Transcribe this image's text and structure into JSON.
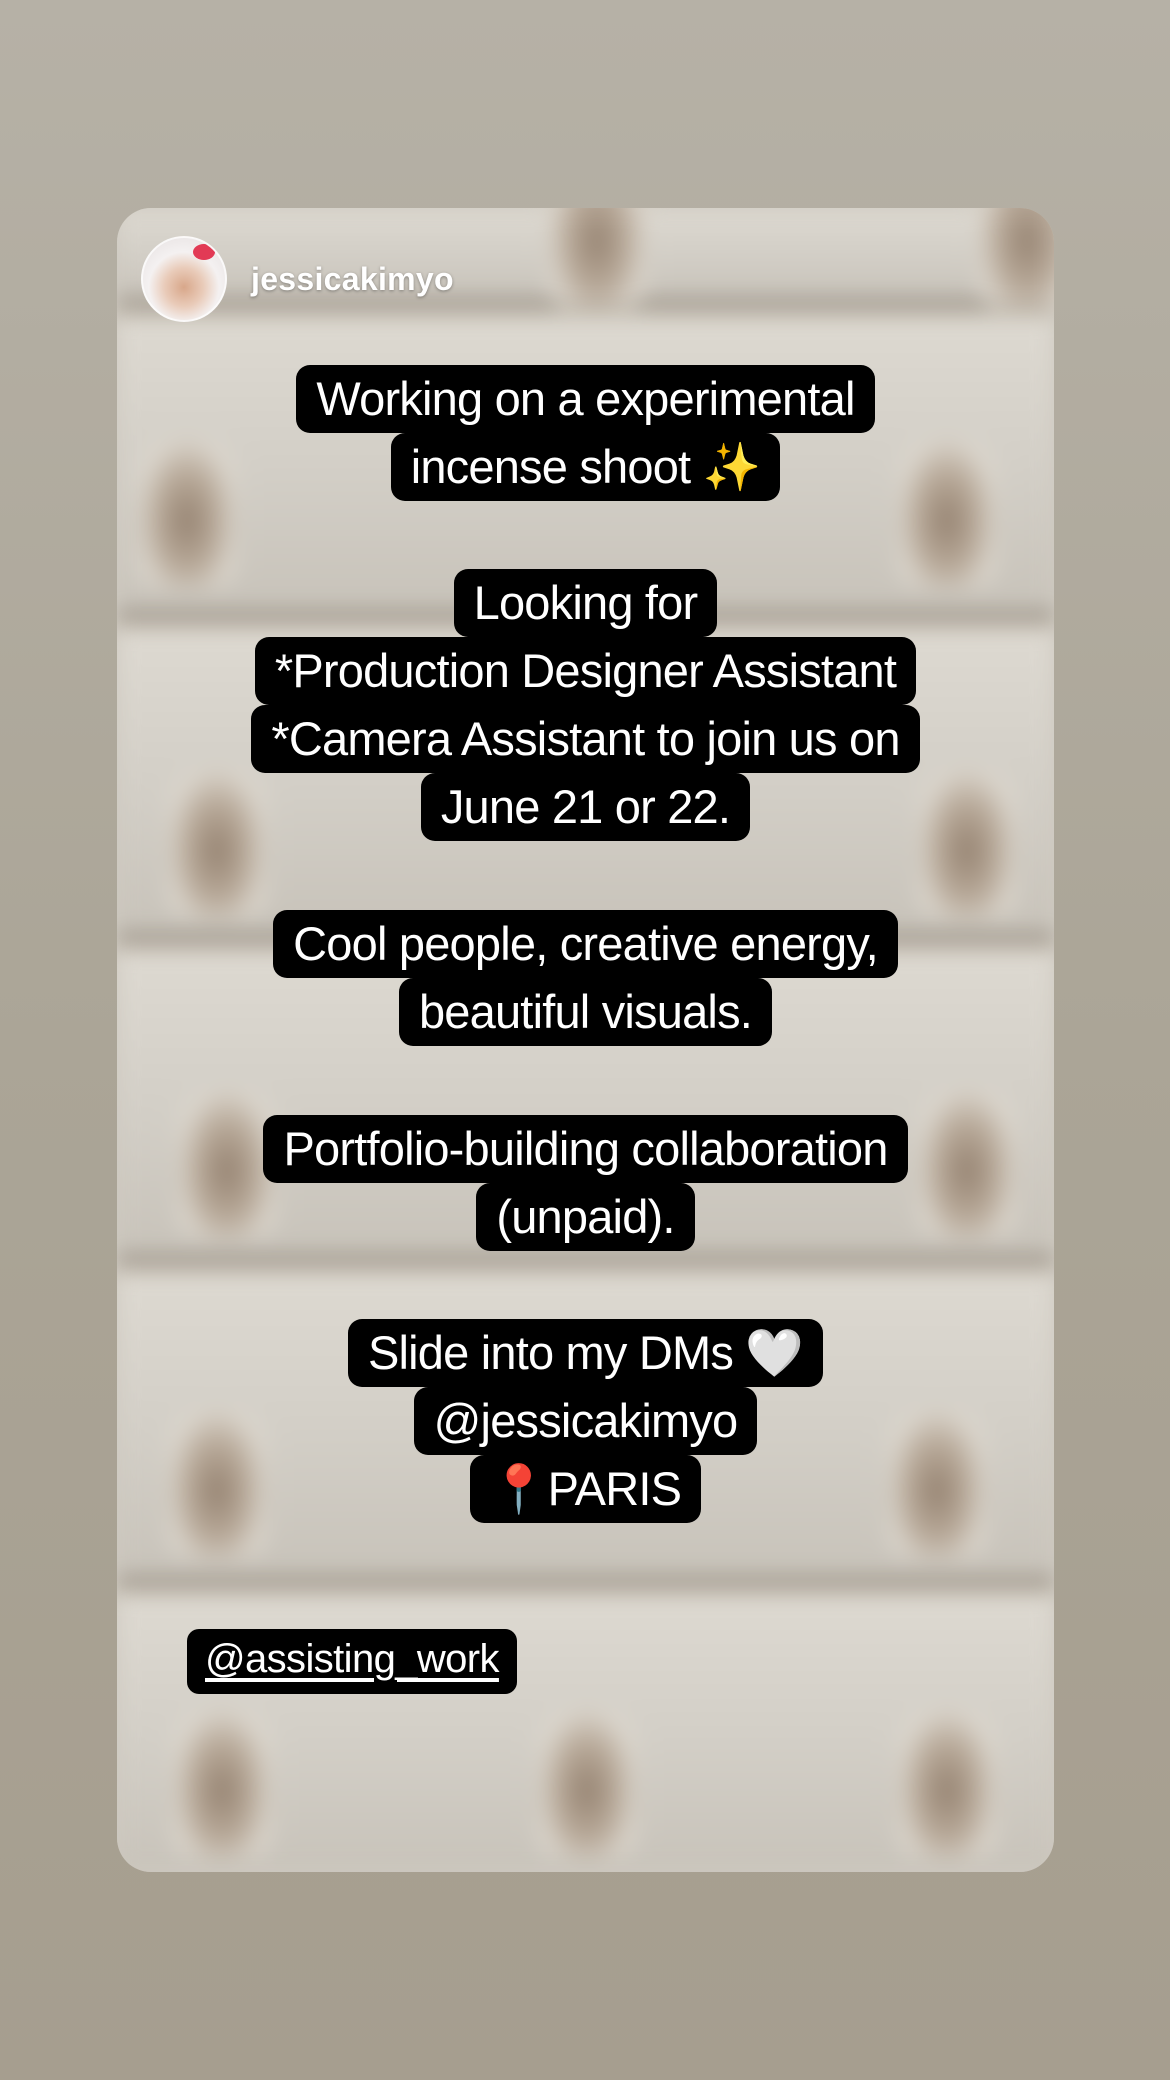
{
  "account": {
    "username": "jessicakimyo"
  },
  "story": {
    "blocks": [
      {
        "lines": [
          "Working on a experimental",
          "incense shoot ✨"
        ]
      },
      {
        "lines": [
          "Looking for",
          "*Production Designer Assistant",
          "*Camera Assistant to join us on",
          "June 21 or 22."
        ]
      },
      {
        "lines": [
          "Cool people, creative energy,",
          "beautiful visuals."
        ]
      },
      {
        "lines": [
          "Portfolio-building collaboration",
          "(unpaid)."
        ]
      },
      {
        "lines": [
          "Slide into my DMs 🤍",
          "@jessicakimyo",
          "📍PARIS"
        ]
      }
    ],
    "mention_tag": "@assisting_work"
  },
  "icons": {
    "avatar": "profile-avatar-hello-kitty-hat"
  }
}
